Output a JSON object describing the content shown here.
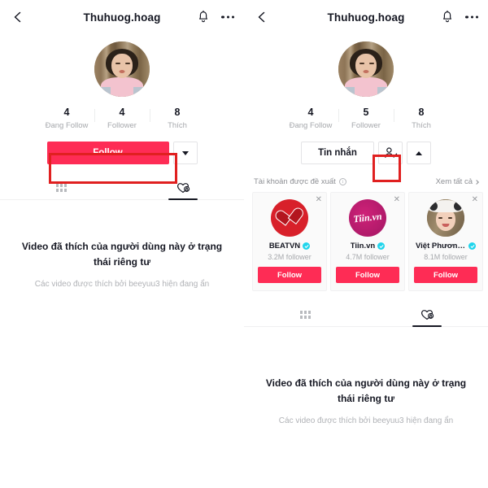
{
  "theme": {
    "accent": "#fe2c55",
    "annotation": "#e02020",
    "verified_blue": "#20d5ec",
    "text_primary": "#161823",
    "text_muted": "#a6a8ac"
  },
  "left": {
    "header": {
      "title": "Thuhuog.hoag",
      "back_icon": "chevron-left-icon",
      "bell_icon": "bell-icon",
      "more_icon": "more-options-icon"
    },
    "avatar_alt": "profile-avatar",
    "stats": [
      {
        "value": "4",
        "label": "Đang Follow"
      },
      {
        "value": "4",
        "label": "Follower"
      },
      {
        "value": "8",
        "label": "Thích"
      }
    ],
    "actions": {
      "follow_label": "Follow",
      "caret_icon": "chevron-down-icon"
    },
    "tabs": [
      {
        "icon": "grid-icon",
        "active": false
      },
      {
        "icon": "heart-lock-icon",
        "active": true
      }
    ],
    "empty": {
      "title": "Video đã thích của người dùng này ở trạng thái riêng tư",
      "subtitle": "Các video được thích bởi beeyuu3 hiện đang ẩn"
    }
  },
  "right": {
    "header": {
      "title": "Thuhuog.hoag",
      "back_icon": "chevron-left-icon",
      "bell_icon": "bell-icon",
      "more_icon": "more-options-icon"
    },
    "avatar_alt": "profile-avatar",
    "stats": [
      {
        "value": "4",
        "label": "Đang Follow"
      },
      {
        "value": "5",
        "label": "Follower"
      },
      {
        "value": "8",
        "label": "Thích"
      }
    ],
    "actions": {
      "message_label": "Tin nhắn",
      "person_check_icon": "person-check-icon",
      "caret_icon": "chevron-up-icon"
    },
    "suggested": {
      "title": "Tài khoản được đề xuất",
      "info_icon": "info-icon",
      "see_all": "Xem tất cả",
      "see_all_icon": "chevron-right-icon",
      "close_icon": "close-icon",
      "cards": [
        {
          "name": "BEATVN",
          "verified": true,
          "followers": "3.2M follower",
          "follow_label": "Follow",
          "avatar": "beatvn-avatar"
        },
        {
          "name": "Tiin.vn",
          "verified": true,
          "followers": "4.7M follower",
          "follow_label": "Follow",
          "avatar": "tiin-avatar",
          "logo_text": "Tiin.vn"
        },
        {
          "name": "Việt Phương Th...",
          "verified": true,
          "followers": "8.1M follower",
          "follow_label": "Follow",
          "avatar": "viet-phuong-avatar"
        }
      ]
    },
    "tabs": [
      {
        "icon": "grid-icon",
        "active": false
      },
      {
        "icon": "heart-lock-icon",
        "active": true
      }
    ],
    "empty": {
      "title": "Video đã thích của người dùng này ở trạng thái riêng tư",
      "subtitle": "Các video được thích bởi beeyuu3 hiện đang ẩn"
    }
  }
}
